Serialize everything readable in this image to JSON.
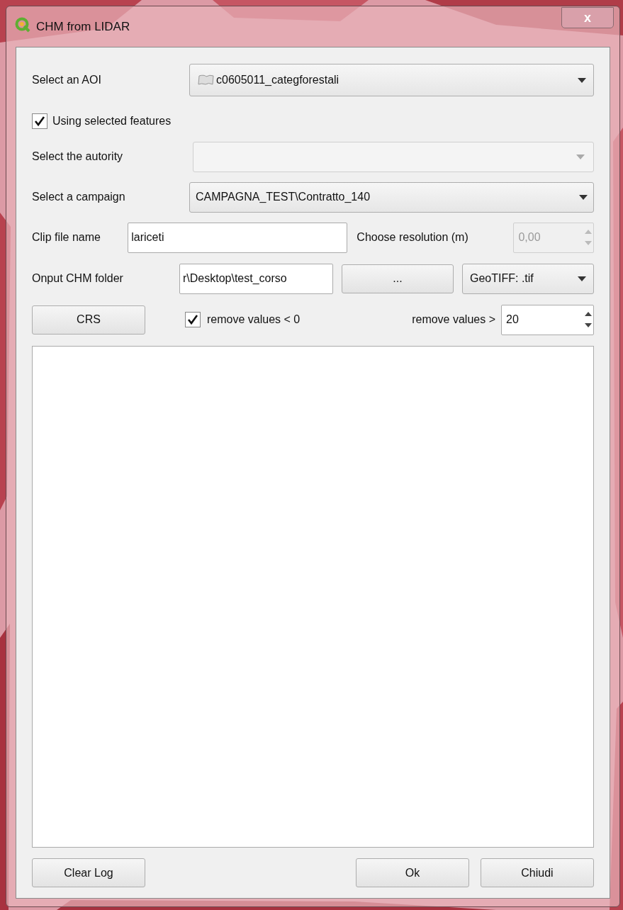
{
  "window": {
    "title": "CHM from LIDAR",
    "close": "x"
  },
  "aoi": {
    "label": "Select an AOI",
    "value": "c0605011_categforestali"
  },
  "use_selected": {
    "label": "Using selected features",
    "checked": true
  },
  "authority": {
    "label": "Select the autority",
    "disabled": true
  },
  "campaign": {
    "label": "Select a campaign",
    "value": "CAMPAGNA_TEST\\Contratto_140"
  },
  "clip": {
    "label": "Clip file name",
    "value": "lariceti"
  },
  "resolution": {
    "label": "Choose resolution (m)",
    "value": "0,00",
    "disabled": true
  },
  "output": {
    "label": "Onput CHM folder",
    "value": "r\\Desktop\\test_corso",
    "browse": "...",
    "format": "GeoTIFF: .tif"
  },
  "crs_button": "CRS",
  "remove_negative": {
    "label": "remove values < 0",
    "checked": true
  },
  "remove_above": {
    "label": "remove values >",
    "value": "20"
  },
  "buttons": [
    {
      "label": "Clear Log",
      "kind": "left"
    },
    {
      "label": "Ok",
      "kind": "right"
    },
    {
      "label": "Chiudi",
      "kind": "right"
    }
  ]
}
